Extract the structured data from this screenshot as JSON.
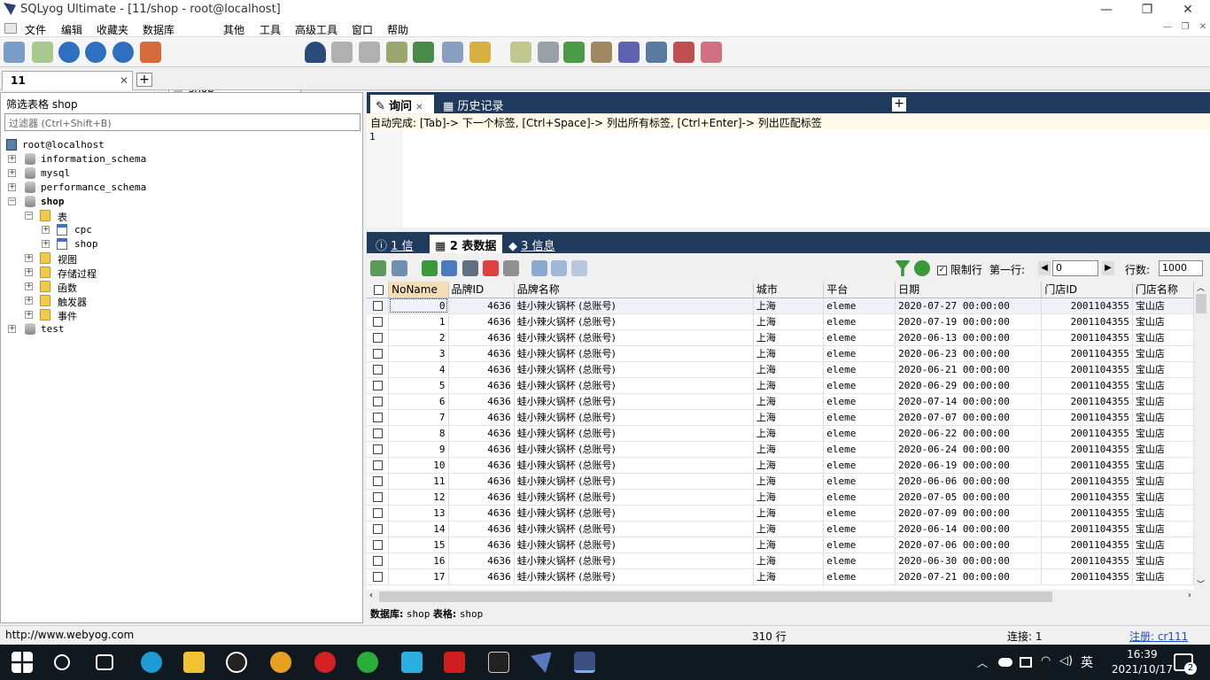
{
  "window": {
    "title": "SQLyog Ultimate - [11/shop - root@localhost]",
    "min_glyph": "—",
    "restore_glyph": "❐",
    "close_glyph": "✕"
  },
  "menu": [
    "文件",
    "编辑",
    "收藏夹",
    "数据库",
    "其他",
    "工具",
    "高级工具",
    "窗口",
    "帮助"
  ],
  "toolbar": {
    "db_selector": "shop"
  },
  "session": {
    "tab_label": "11",
    "close": "✕",
    "add": "+"
  },
  "object_browser": {
    "title": "筛选表格 shop",
    "filter_placeholder": "过滤器 (Ctrl+Shift+B)",
    "root": "root@localhost",
    "databases": [
      "information_schema",
      "mysql",
      "performance_schema",
      "shop",
      "test"
    ],
    "shop_children": {
      "tables_folder": "表",
      "tables": [
        "cpc",
        "shop"
      ],
      "folders": [
        "视图",
        "存储过程",
        "函数",
        "触发器",
        "事件"
      ]
    }
  },
  "query_tabs": {
    "query": "询问",
    "history": "历史记录",
    "add": "+"
  },
  "autocomplete_hint": "自动完成: [Tab]-> 下一个标签, [Ctrl+Space]-> 列出所有标签, [Ctrl+Enter]-> 列出匹配标签",
  "editor": {
    "line_number": "1"
  },
  "result_tabs": [
    {
      "label": "1 信息"
    },
    {
      "label": "2 表数据"
    },
    {
      "label": "3 信息"
    }
  ],
  "result_toolbar": {
    "limit_label": "限制行",
    "limit_checked": true,
    "first_row_label": "第一行:",
    "first_row_value": "0",
    "rows_label": "行数:",
    "rows_value": "1000"
  },
  "grid": {
    "columns": [
      "NoName",
      "品牌ID",
      "品牌名称",
      "城市",
      "平台",
      "日期",
      "门店ID",
      "门店名称"
    ],
    "brand_id": "4636",
    "brand_name": "蛙小辣火锅杯 (总账号)",
    "city": "上海",
    "platform": "eleme",
    "store_id": "2001104355",
    "store_name": "宝山店",
    "rows": [
      {
        "n": "0",
        "date": "2020-07-27 00:00:00"
      },
      {
        "n": "1",
        "date": "2020-07-19 00:00:00"
      },
      {
        "n": "2",
        "date": "2020-06-13 00:00:00"
      },
      {
        "n": "3",
        "date": "2020-06-23 00:00:00"
      },
      {
        "n": "4",
        "date": "2020-06-21 00:00:00"
      },
      {
        "n": "5",
        "date": "2020-06-29 00:00:00"
      },
      {
        "n": "6",
        "date": "2020-07-14 00:00:00"
      },
      {
        "n": "7",
        "date": "2020-07-07 00:00:00"
      },
      {
        "n": "8",
        "date": "2020-06-22 00:00:00"
      },
      {
        "n": "9",
        "date": "2020-06-24 00:00:00"
      },
      {
        "n": "10",
        "date": "2020-06-19 00:00:00"
      },
      {
        "n": "11",
        "date": "2020-06-06 00:00:00"
      },
      {
        "n": "12",
        "date": "2020-07-05 00:00:00"
      },
      {
        "n": "13",
        "date": "2020-07-09 00:00:00"
      },
      {
        "n": "14",
        "date": "2020-06-14 00:00:00"
      },
      {
        "n": "15",
        "date": "2020-07-06 00:00:00"
      },
      {
        "n": "16",
        "date": "2020-06-30 00:00:00"
      },
      {
        "n": "17",
        "date": "2020-07-21 00:00:00"
      }
    ]
  },
  "result_footer": {
    "db_label": "数据库:",
    "db": "shop",
    "table_label": "表格:",
    "table": "shop"
  },
  "status": {
    "url": "http://www.webyog.com",
    "rows": "310 行",
    "connections": "连接: 1",
    "register": "注册: cr111"
  },
  "taskbar": {
    "time": "16:39",
    "date": "2021/10/17",
    "ime": "英",
    "notifications": "2"
  },
  "colors": {
    "tab_header_bg": "#1f3a5c",
    "autocomplete_bg": "#fffbe8",
    "taskbar_bg": "#101820"
  }
}
